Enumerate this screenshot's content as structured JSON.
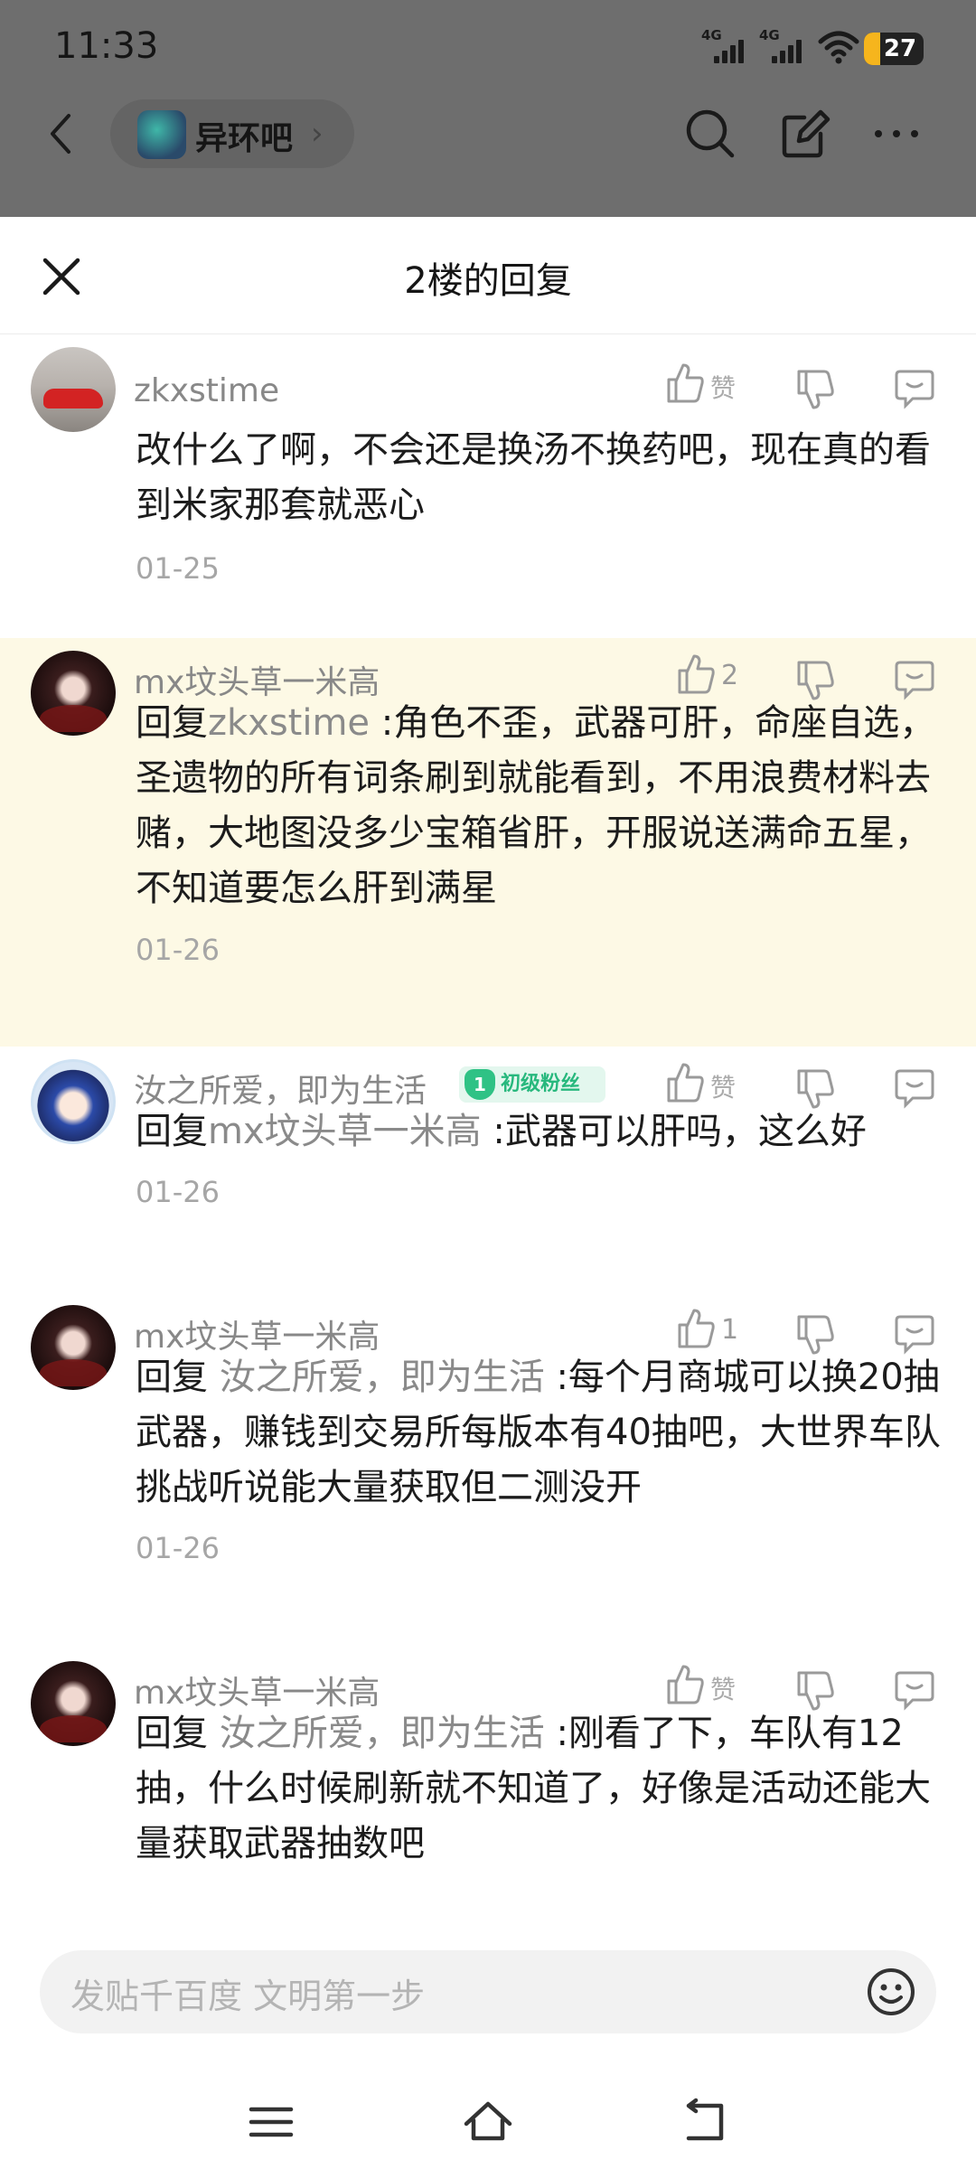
{
  "status_bar": {
    "time": "11:33",
    "sim1": "4G",
    "sim2": "4G",
    "battery": "27",
    "battery_level": 0.27
  },
  "nav": {
    "forum_name": "异环吧"
  },
  "sheet": {
    "title": "2楼的回复"
  },
  "comments": [
    {
      "user": "zkxstime",
      "like_label": "赞",
      "text": "改什么了啊，不会还是换汤不换药吧，现在真的看到米家那套就恶心",
      "date": "01-25"
    },
    {
      "user": "mx坟头草一米高",
      "like_label": "2",
      "reply_prefix": "回复",
      "reply_to": "zkxstime",
      "text": ":角色不歪，武器可肝，命座自选，圣遗物的所有词条刷到就能看到，不用浪费材料去赌，大地图没多少宝箱省肝，开服说送满命五星，不知道要怎么肝到满星",
      "date": "01-26"
    },
    {
      "user": "汝之所爱，即为生活",
      "badge_level": "1",
      "badge_label": "初级粉丝",
      "like_label": "赞",
      "reply_prefix": "回复",
      "reply_to": "mx坟头草一米高",
      "text": ":武器可以肝吗，这么好",
      "date": "01-26"
    },
    {
      "user": "mx坟头草一米高",
      "like_label": "1",
      "reply_prefix": "回复",
      "reply_to": "汝之所爱，即为生活",
      "text": ":每个月商城可以换20抽武器，赚钱到交易所每版本有40抽吧，大世界车队挑战听说能大量获取但二测没开",
      "date": "01-26"
    },
    {
      "user": "mx坟头草一米高",
      "like_label": "赞",
      "reply_prefix": "回复",
      "reply_to": "汝之所爱，即为生活",
      "text": ":刚看了下，车队有12抽，什么时候刷新就不知道了，好像是活动还能大量获取武器抽数吧"
    }
  ],
  "input": {
    "placeholder": "发贴千百度 文明第一步"
  }
}
